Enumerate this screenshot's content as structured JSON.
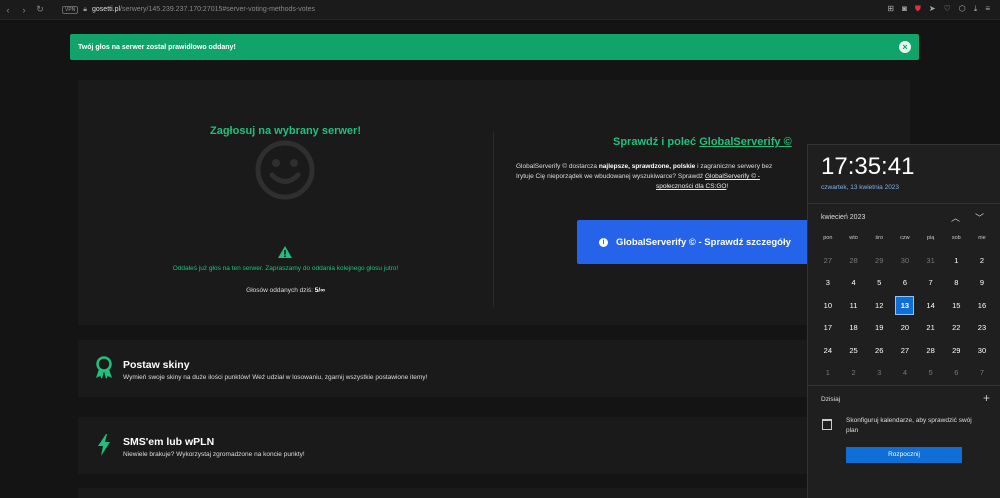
{
  "browser": {
    "vpn_label": "VPN",
    "url_host": "gosetti.pl",
    "url_path": "/serwery/145.239.237.170:27015#server-voting-methods-votes"
  },
  "alert": {
    "message": "Twój głos na serwer został prawidłowo oddany!",
    "close": "×"
  },
  "vote": {
    "title": "Zagłosuj na wybrany serwer!",
    "message": "Oddałeś już głos na ten serwer. Zapraszamy do oddania kolejnego głosu jutro!",
    "votes_label": "Głosów oddanych dziś:",
    "votes_value": "5/∞"
  },
  "globalserverify": {
    "title_prefix": "Sprawdź i poleć",
    "title_link": "GlobalServerify ©",
    "desc_1": "GlobalServerify © dostarcza",
    "desc_bold": "najlepsze, sprawdzone, polskie",
    "desc_2": "i zagraniczne serwery bez",
    "desc_3": "Irytuje Cię nieporządek we wbudowanej wyszukiwarce? Sprawdź",
    "desc_link1": "GlobalServerify © -",
    "desc_link2": "społeczności dla CS:GO",
    "desc_end": "!",
    "button_label": "GlobalServerify © - Sprawdź szczegóły"
  },
  "cards": [
    {
      "title": "Postaw skiny",
      "subtitle": "Wymień swoje skiny na duże ilości punktów! Weź udział w losowaniu, zgarnij wszystkie postawione itemy!"
    },
    {
      "title": "SMS'em lub wPLN",
      "subtitle": "Niewiele brakuje? Wykorzystaj zgromadzone na koncie punkty!"
    }
  ],
  "calendar": {
    "time": "17:35:41",
    "date": "czwartek, 13 kwietnia 2023",
    "month_label": "kwiecień 2023",
    "weekdays": [
      "pon",
      "wto",
      "śro",
      "czw",
      "pią",
      "sob",
      "nie"
    ],
    "days": [
      [
        "27",
        "28",
        "29",
        "30",
        "31",
        "1",
        "2"
      ],
      [
        "3",
        "4",
        "5",
        "6",
        "7",
        "8",
        "9"
      ],
      [
        "10",
        "11",
        "12",
        "13",
        "14",
        "15",
        "16"
      ],
      [
        "17",
        "18",
        "19",
        "20",
        "21",
        "22",
        "23"
      ],
      [
        "24",
        "25",
        "26",
        "27",
        "28",
        "29",
        "30"
      ],
      [
        "1",
        "2",
        "3",
        "4",
        "5",
        "6",
        "7"
      ]
    ],
    "today_label": "Dzisiaj",
    "config_text": "Skonfiguruj kalendarze, aby sprawdzić swój plan",
    "start_button": "Rozpocznij"
  },
  "colors": {
    "accent_green": "#1fc07c",
    "alert_green": "#10a36a",
    "button_blue": "#2563eb",
    "today_blue": "#0f6fd6"
  }
}
